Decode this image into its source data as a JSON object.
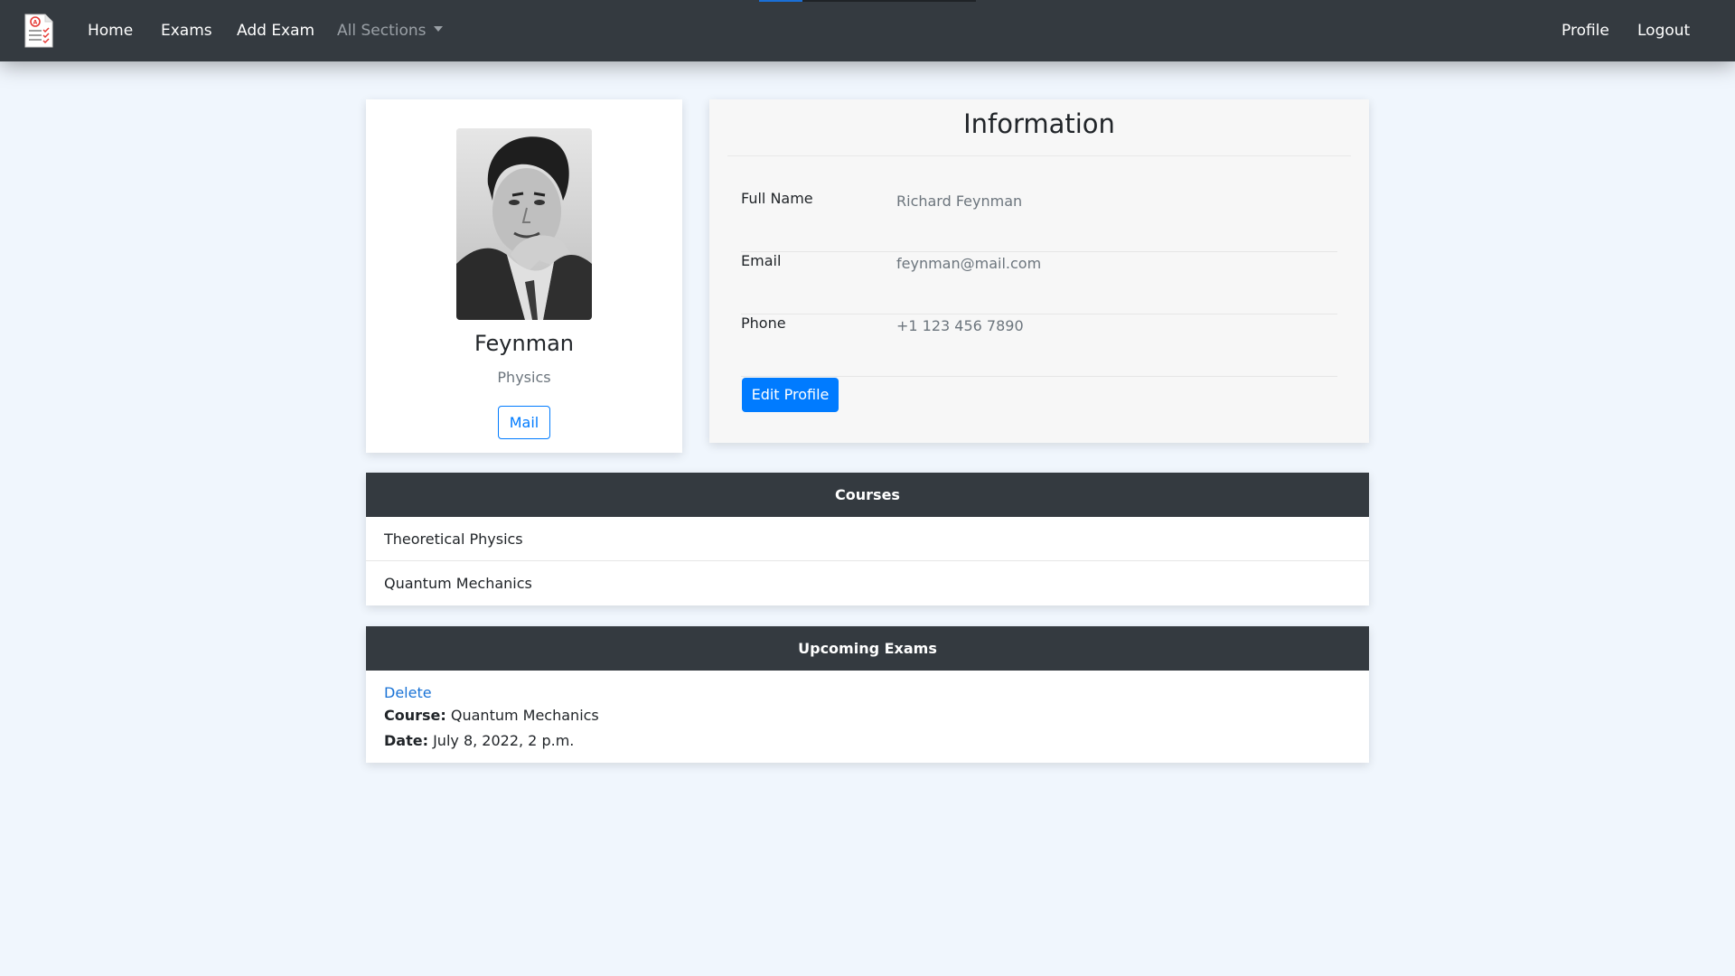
{
  "nav": {
    "home": "Home",
    "exams": "Exams",
    "add_exam": "Add Exam",
    "all_sections": "All Sections",
    "profile": "Profile",
    "logout": "Logout",
    "brand_icon": "exam-checklist-icon",
    "progress": 0.2
  },
  "profile": {
    "name": "Feynman",
    "subject": "Physics",
    "mail_label": "Mail",
    "photo": "portrait-photo"
  },
  "information": {
    "title": "Information",
    "rows": [
      {
        "label": "Full Name",
        "value": "Richard Feynman"
      },
      {
        "label": "Email",
        "value": "feynman@mail.com"
      },
      {
        "label": "Phone",
        "value": "+1 123 456 7890"
      }
    ],
    "edit_label": "Edit Profile"
  },
  "courses": {
    "title": "Courses",
    "items": [
      "Theoretical Physics",
      "Quantum Mechanics"
    ]
  },
  "exams": {
    "title": "Upcoming Exams",
    "items": [
      {
        "delete_label": "Delete",
        "course_label": "Course:",
        "course": "Quantum Mechanics",
        "date_label": "Date:",
        "date": "July 8, 2022, 2 p.m."
      }
    ]
  },
  "colors": {
    "navbar": "#343a40",
    "background": "#f0f6fd",
    "primary": "#007bff"
  }
}
